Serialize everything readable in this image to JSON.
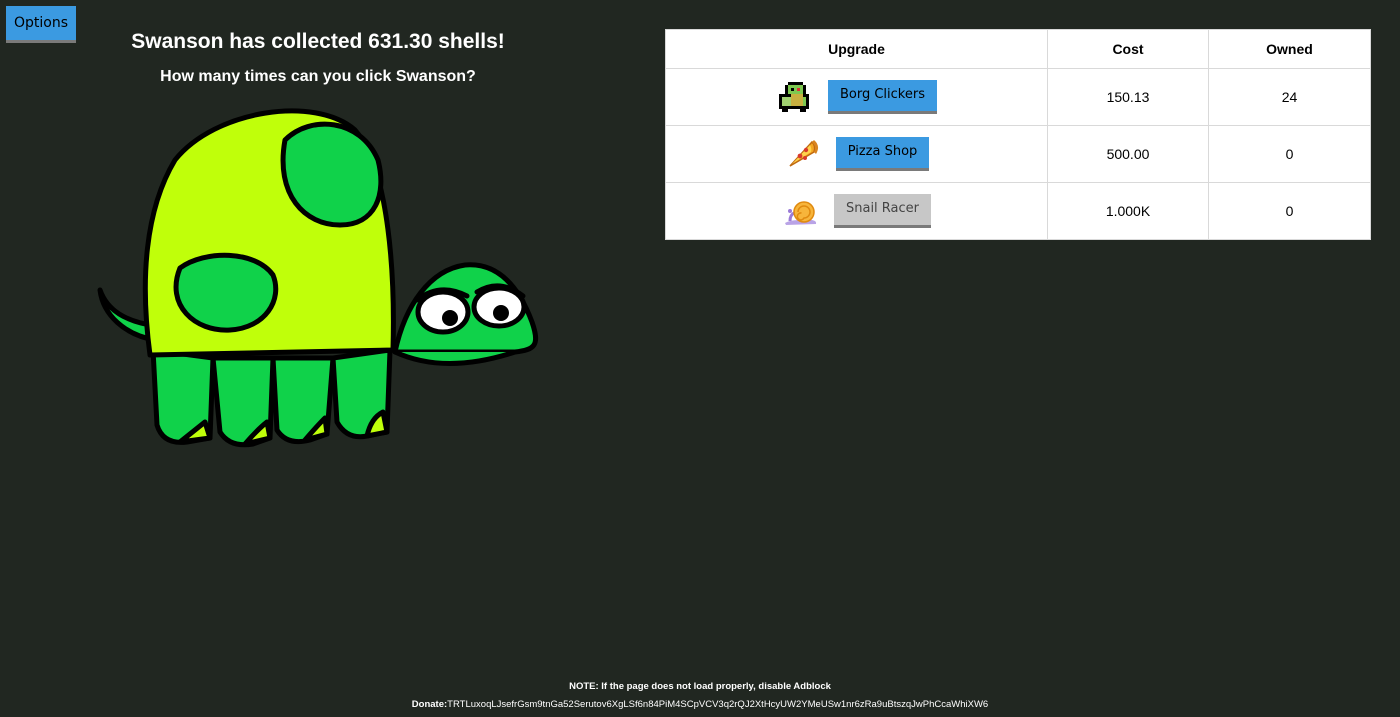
{
  "options_button": {
    "label": "Options"
  },
  "header": {
    "collected_text": "Swanson has collected 631.30 shells!",
    "question_text": "How many times can you click Swanson?"
  },
  "upgrades_table": {
    "columns": [
      "Upgrade",
      "Cost",
      "Owned"
    ],
    "rows": [
      {
        "icon": "pixel-turtle-icon",
        "name": "Borg Clickers",
        "cost": "150.13",
        "owned": "24",
        "affordable": true
      },
      {
        "icon": "pizza-icon",
        "name": "Pizza Shop",
        "cost": "500.00",
        "owned": "0",
        "affordable": true
      },
      {
        "icon": "snail-icon",
        "name": "Snail Racer",
        "cost": "1.000K",
        "owned": "0",
        "affordable": false
      }
    ]
  },
  "footer": {
    "note": "NOTE: If the page does not load properly, disable Adblock",
    "donate_label": "Donate:",
    "donate_address": "TRTLuxoqLJsefrGsm9tnGa52Serutov6XgLSf6n84PiM4SCpVCV3q2rQJ2XtHcyUW2YMeUSw1nr6zRa9uBtszqJwPhCcaWhiXW6"
  },
  "colors": {
    "background": "#212721",
    "button_blue": "#3b9ae1",
    "button_disabled": "#c7c7c7",
    "shell_yellow": "#c0ff0a",
    "turtle_green": "#10d24a"
  }
}
